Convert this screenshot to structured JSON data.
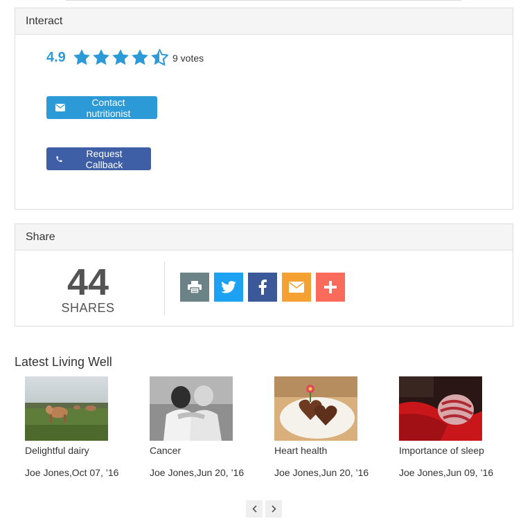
{
  "interact": {
    "heading": "Interact",
    "rating": {
      "value": "4.9",
      "stars_filled": 4.5,
      "stars_total": 5,
      "votes": "9 votes"
    },
    "contact_label": "Contact nutritionist",
    "callback_label": "Request Callback"
  },
  "share": {
    "heading": "Share",
    "count": "44",
    "count_label": "SHARES",
    "buttons": [
      "print-icon",
      "twitter-icon",
      "facebook-icon",
      "email-icon",
      "plus-icon"
    ]
  },
  "latest": {
    "title": "Latest Living Well",
    "articles": [
      {
        "title": "Delightful dairy",
        "meta": "Joe Jones,Oct 07, ’16"
      },
      {
        "title": "Cancer",
        "meta": "Joe Jones,Jun 20, ’16"
      },
      {
        "title": "Heart health",
        "meta": "Joe Jones,Jun 20, ’16"
      },
      {
        "title": "Importance of sleep",
        "meta": "Joe Jones,Jun 09, ’16"
      }
    ]
  },
  "colors": {
    "primary": "#2d9ad8",
    "callback": "#3e5fa5",
    "twitter": "#1da1f2",
    "facebook": "#3b5998",
    "email": "#f4a032",
    "more": "#fb6b5b",
    "print": "#6b8286"
  }
}
